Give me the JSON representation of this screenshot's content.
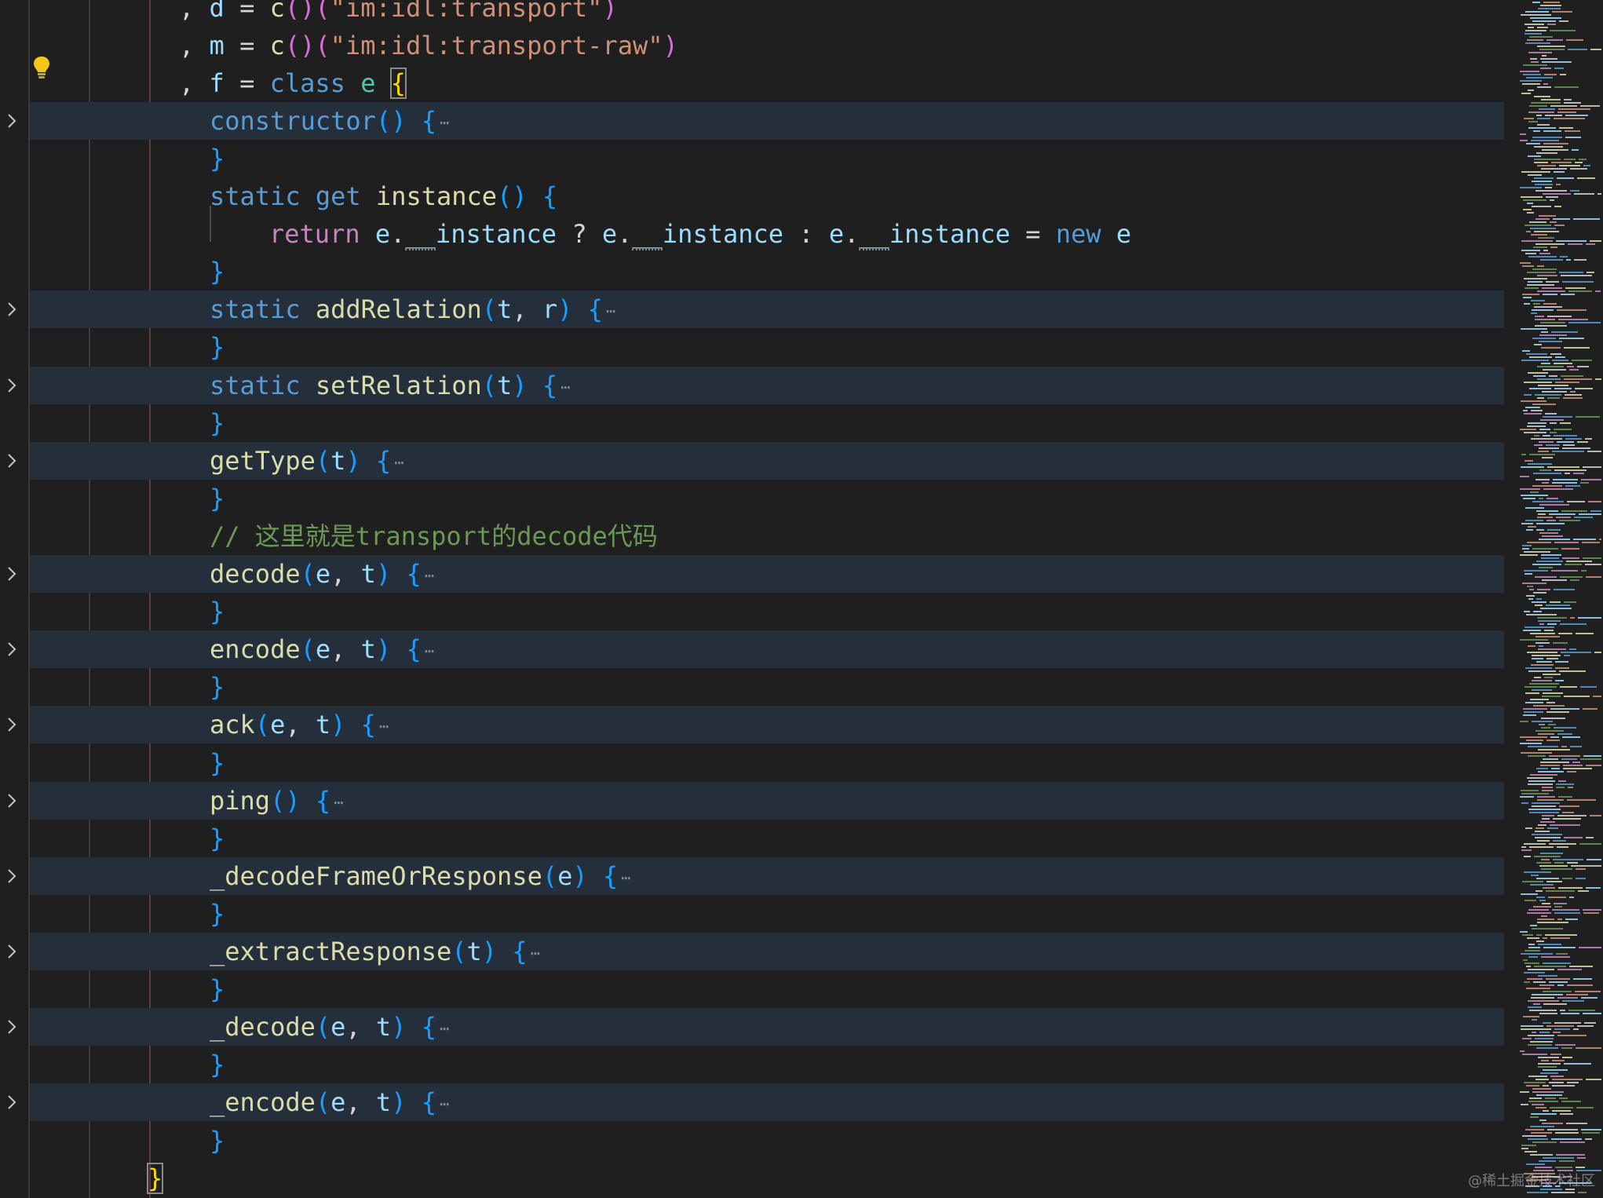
{
  "editor": {
    "language": "javascript",
    "theme": "dark",
    "colors": {
      "background": "#1f1f1f",
      "folded_line_background": "#252f3c",
      "keyword": "#569cd6",
      "function": "#dcdcaa",
      "variable": "#9cdcfe",
      "string": "#ce9178",
      "comment": "#6a9955",
      "bracket_1": "#ffd700",
      "bracket_2": "#da70d6",
      "bracket_3": "#179fff"
    },
    "lines": [
      {
        "tokens": [
          [
            "punc",
            ", "
          ],
          [
            "var",
            "d"
          ],
          [
            "punc",
            " = "
          ],
          [
            "fn",
            "c"
          ],
          [
            "br2",
            "()"
          ],
          [
            "br2",
            "("
          ],
          [
            "str",
            "\"im:idl:transport\""
          ],
          [
            "br2",
            ")"
          ]
        ],
        "folded": false
      },
      {
        "tokens": [
          [
            "punc",
            ", "
          ],
          [
            "var",
            "m"
          ],
          [
            "punc",
            " = "
          ],
          [
            "fn",
            "c"
          ],
          [
            "br2",
            "()"
          ],
          [
            "br2",
            "("
          ],
          [
            "str",
            "\"im:idl:transport-raw\""
          ],
          [
            "br2",
            ")"
          ]
        ],
        "folded": false
      },
      {
        "tokens": [
          [
            "punc",
            ", "
          ],
          [
            "var",
            "f"
          ],
          [
            "punc",
            " = "
          ],
          [
            "kw",
            "class"
          ],
          [
            "punc",
            " "
          ],
          [
            "cls",
            "e"
          ],
          [
            "punc",
            " "
          ],
          [
            "br1m",
            "{"
          ]
        ],
        "folded": false,
        "lightbulb": true
      },
      {
        "tokens": [
          [
            "kw",
            "constructor"
          ],
          [
            "br3",
            "()"
          ],
          [
            "punc",
            " "
          ],
          [
            "br3",
            "{"
          ],
          [
            "ell",
            "⋯"
          ]
        ],
        "folded": true
      },
      {
        "tokens": [
          [
            "br3",
            "}"
          ]
        ],
        "folded": false
      },
      {
        "tokens": [
          [
            "kw",
            "static"
          ],
          [
            "punc",
            " "
          ],
          [
            "kw",
            "get"
          ],
          [
            "punc",
            " "
          ],
          [
            "fn",
            "instance"
          ],
          [
            "br3",
            "()"
          ],
          [
            "punc",
            " "
          ],
          [
            "br3",
            "{"
          ]
        ],
        "folded": false
      },
      {
        "tokens": [
          [
            "ctrl",
            "return"
          ],
          [
            "punc",
            " "
          ],
          [
            "var",
            "e"
          ],
          [
            "punc",
            "."
          ],
          [
            "vard",
            "__instance"
          ],
          [
            "punc",
            " ? "
          ],
          [
            "var",
            "e"
          ],
          [
            "punc",
            "."
          ],
          [
            "vard",
            "__instance"
          ],
          [
            "punc",
            " : "
          ],
          [
            "var",
            "e"
          ],
          [
            "punc",
            "."
          ],
          [
            "vard",
            "__instance"
          ],
          [
            "punc",
            " = "
          ],
          [
            "kw",
            "new"
          ],
          [
            "punc",
            " "
          ],
          [
            "var",
            "e"
          ]
        ],
        "folded": false,
        "indent": 2
      },
      {
        "tokens": [
          [
            "br3",
            "}"
          ]
        ],
        "folded": false
      },
      {
        "tokens": [
          [
            "kw",
            "static"
          ],
          [
            "punc",
            " "
          ],
          [
            "fn",
            "addRelation"
          ],
          [
            "br3",
            "("
          ],
          [
            "var",
            "t"
          ],
          [
            "punc",
            ", "
          ],
          [
            "var",
            "r"
          ],
          [
            "br3",
            ")"
          ],
          [
            "punc",
            " "
          ],
          [
            "br3",
            "{"
          ],
          [
            "ell",
            "⋯"
          ]
        ],
        "folded": true
      },
      {
        "tokens": [
          [
            "br3",
            "}"
          ]
        ],
        "folded": false
      },
      {
        "tokens": [
          [
            "kw",
            "static"
          ],
          [
            "punc",
            " "
          ],
          [
            "fn",
            "setRelation"
          ],
          [
            "br3",
            "("
          ],
          [
            "var",
            "t"
          ],
          [
            "br3",
            ")"
          ],
          [
            "punc",
            " "
          ],
          [
            "br3",
            "{"
          ],
          [
            "ell",
            "⋯"
          ]
        ],
        "folded": true
      },
      {
        "tokens": [
          [
            "br3",
            "}"
          ]
        ],
        "folded": false
      },
      {
        "tokens": [
          [
            "fn",
            "getType"
          ],
          [
            "br3",
            "("
          ],
          [
            "var",
            "t"
          ],
          [
            "br3",
            ")"
          ],
          [
            "punc",
            " "
          ],
          [
            "br3",
            "{"
          ],
          [
            "ell",
            "⋯"
          ]
        ],
        "folded": true
      },
      {
        "tokens": [
          [
            "br3",
            "}"
          ]
        ],
        "folded": false
      },
      {
        "tokens": [
          [
            "cmt",
            "// 这里就是transport的decode代码"
          ]
        ],
        "folded": false
      },
      {
        "tokens": [
          [
            "fn",
            "decode"
          ],
          [
            "br3",
            "("
          ],
          [
            "var",
            "e"
          ],
          [
            "punc",
            ", "
          ],
          [
            "var",
            "t"
          ],
          [
            "br3",
            ")"
          ],
          [
            "punc",
            " "
          ],
          [
            "br3",
            "{"
          ],
          [
            "ell",
            "⋯"
          ]
        ],
        "folded": true
      },
      {
        "tokens": [
          [
            "br3",
            "}"
          ]
        ],
        "folded": false
      },
      {
        "tokens": [
          [
            "fn",
            "encode"
          ],
          [
            "br3",
            "("
          ],
          [
            "var",
            "e"
          ],
          [
            "punc",
            ", "
          ],
          [
            "var",
            "t"
          ],
          [
            "br3",
            ")"
          ],
          [
            "punc",
            " "
          ],
          [
            "br3",
            "{"
          ],
          [
            "ell",
            "⋯"
          ]
        ],
        "folded": true
      },
      {
        "tokens": [
          [
            "br3",
            "}"
          ]
        ],
        "folded": false
      },
      {
        "tokens": [
          [
            "fn",
            "ack"
          ],
          [
            "br3",
            "("
          ],
          [
            "var",
            "e"
          ],
          [
            "punc",
            ", "
          ],
          [
            "var",
            "t"
          ],
          [
            "br3",
            ")"
          ],
          [
            "punc",
            " "
          ],
          [
            "br3",
            "{"
          ],
          [
            "ell",
            "⋯"
          ]
        ],
        "folded": true
      },
      {
        "tokens": [
          [
            "br3",
            "}"
          ]
        ],
        "folded": false
      },
      {
        "tokens": [
          [
            "fn",
            "ping"
          ],
          [
            "br3",
            "()"
          ],
          [
            "punc",
            " "
          ],
          [
            "br3",
            "{"
          ],
          [
            "ell",
            "⋯"
          ]
        ],
        "folded": true
      },
      {
        "tokens": [
          [
            "br3",
            "}"
          ]
        ],
        "folded": false
      },
      {
        "tokens": [
          [
            "fn",
            "_decodeFrameOrResponse"
          ],
          [
            "br3",
            "("
          ],
          [
            "var",
            "e"
          ],
          [
            "br3",
            ")"
          ],
          [
            "punc",
            " "
          ],
          [
            "br3",
            "{"
          ],
          [
            "ell",
            "⋯"
          ]
        ],
        "folded": true
      },
      {
        "tokens": [
          [
            "br3",
            "}"
          ]
        ],
        "folded": false
      },
      {
        "tokens": [
          [
            "fn",
            "_extractResponse"
          ],
          [
            "br3",
            "("
          ],
          [
            "var",
            "t"
          ],
          [
            "br3",
            ")"
          ],
          [
            "punc",
            " "
          ],
          [
            "br3",
            "{"
          ],
          [
            "ell",
            "⋯"
          ]
        ],
        "folded": true
      },
      {
        "tokens": [
          [
            "br3",
            "}"
          ]
        ],
        "folded": false
      },
      {
        "tokens": [
          [
            "fn",
            "_decode"
          ],
          [
            "br3",
            "("
          ],
          [
            "var",
            "e"
          ],
          [
            "punc",
            ", "
          ],
          [
            "var",
            "t"
          ],
          [
            "br3",
            ")"
          ],
          [
            "punc",
            " "
          ],
          [
            "br3",
            "{"
          ],
          [
            "ell",
            "⋯"
          ]
        ],
        "folded": true
      },
      {
        "tokens": [
          [
            "br3",
            "}"
          ]
        ],
        "folded": false
      },
      {
        "tokens": [
          [
            "fn",
            "_encode"
          ],
          [
            "br3",
            "("
          ],
          [
            "var",
            "e"
          ],
          [
            "punc",
            ", "
          ],
          [
            "var",
            "t"
          ],
          [
            "br3",
            ")"
          ],
          [
            "punc",
            " "
          ],
          [
            "br3",
            "{"
          ],
          [
            "ell",
            "⋯"
          ]
        ],
        "folded": true
      },
      {
        "tokens": [
          [
            "br3",
            "}"
          ]
        ],
        "folded": false
      },
      {
        "tokens": [
          [
            "br1m",
            "}"
          ]
        ],
        "folded": false,
        "indent": -1
      }
    ],
    "icons": {
      "lightbulb": "lightbulb-icon",
      "fold": "chevron-right-icon"
    }
  },
  "watermark": "@稀土掘金技术社区"
}
